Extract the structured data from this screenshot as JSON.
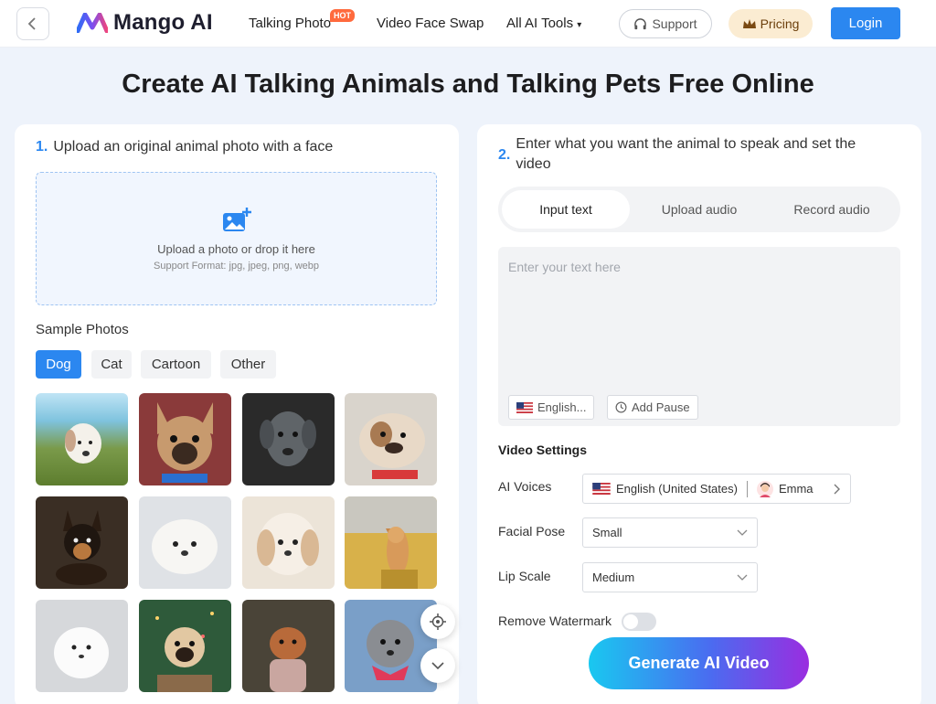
{
  "header": {
    "logo_text": "Mango AI",
    "nav": [
      "Talking Photo",
      "Video Face Swap",
      "All AI Tools"
    ],
    "hot_badge": "HOT",
    "support_label": "Support",
    "pricing_label": "Pricing",
    "login_label": "Login"
  },
  "page_title": "Create AI Talking Animals and Talking Pets Free Online",
  "left": {
    "step_number": "1.",
    "step_title": "Upload an original animal photo with a face",
    "upload_main": "Upload a photo or drop it here",
    "upload_sub": "Support Format: jpg, jpeg, png, webp",
    "sample_label": "Sample Photos",
    "categories": [
      "Dog",
      "Cat",
      "Cartoon",
      "Other"
    ],
    "active_category": "Dog"
  },
  "right": {
    "step_number": "2.",
    "step_title": "Enter what you want the animal to speak and set the video",
    "mode_tabs": [
      "Input text",
      "Upload audio",
      "Record audio"
    ],
    "active_mode": "Input text",
    "text_placeholder": "Enter your text here",
    "language_chip": "English...",
    "add_pause_label": "Add Pause",
    "video_settings_title": "Video Settings",
    "ai_voices_label": "AI Voices",
    "voice_language": "English (United States)",
    "voice_name": "Emma",
    "facial_pose_label": "Facial Pose",
    "facial_pose_value": "Small",
    "lip_scale_label": "Lip Scale",
    "lip_scale_value": "Medium",
    "remove_watermark_label": "Remove Watermark",
    "remove_watermark_on": false,
    "generate_label": "Generate AI Video"
  },
  "colors": {
    "primary": "#2b87f0",
    "pricing_bg": "#fbecd2",
    "hot": "#ff6a3d"
  }
}
